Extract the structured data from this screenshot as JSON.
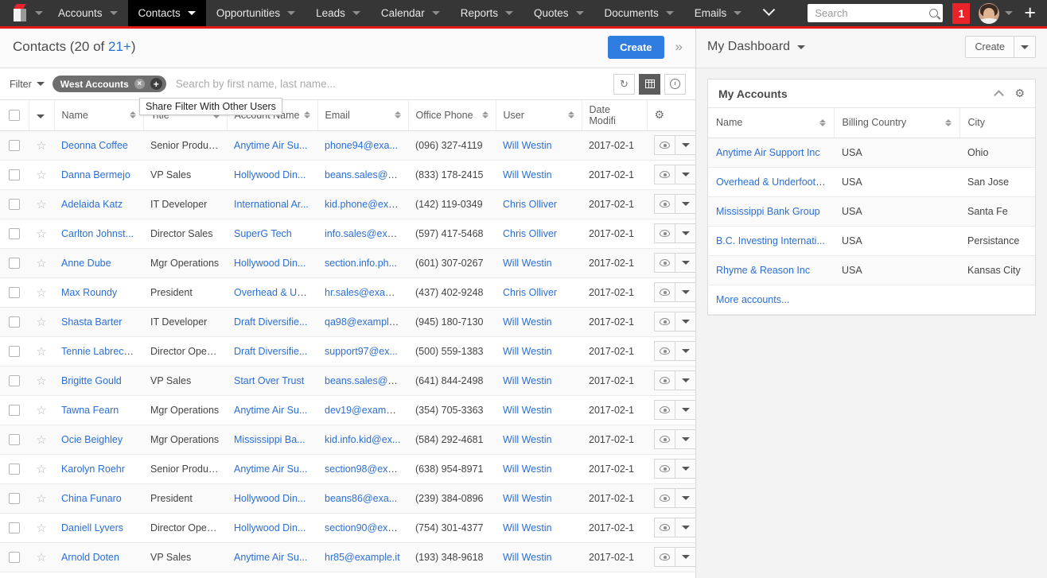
{
  "topnav": {
    "logo_icon": "cube-logo-icon",
    "items": [
      {
        "label": "Accounts",
        "active": false
      },
      {
        "label": "Contacts",
        "active": true
      },
      {
        "label": "Opportunities",
        "active": false
      },
      {
        "label": "Leads",
        "active": false
      },
      {
        "label": "Calendar",
        "active": false
      },
      {
        "label": "Reports",
        "active": false
      },
      {
        "label": "Quotes",
        "active": false
      },
      {
        "label": "Documents",
        "active": false
      },
      {
        "label": "Emails",
        "active": false
      }
    ],
    "search_placeholder": "Search",
    "search_value": "",
    "notification_count": "1",
    "plus_label": "+"
  },
  "list_header": {
    "title_prefix": "Contacts (20 of ",
    "title_count": "21+",
    "title_suffix": ")",
    "create_label": "Create",
    "expand_icon": "»"
  },
  "filter_bar": {
    "filter_label": "Filter",
    "pill_label": "West Accounts",
    "pill_remove": "×",
    "pill_add": "+",
    "search_placeholder": "Search by first name, last name...",
    "search_value": "",
    "tooltip": "Share Filter With Other Users",
    "tools": [
      "refresh-icon",
      "grid-view-icon",
      "timeline-view-icon"
    ]
  },
  "table": {
    "columns": [
      "Name",
      "Title",
      "Account Name",
      "Email",
      "Office Phone",
      "User",
      "Date Modifi"
    ],
    "rows": [
      {
        "name": "Deonna Coffee",
        "title": "Senior Product...",
        "account": "Anytime Air Su...",
        "email": "phone94@exa...",
        "phone": "(096) 327-4119",
        "user": "Will Westin",
        "date": "2017-02-1"
      },
      {
        "name": "Danna Bermejo",
        "title": "VP Sales",
        "account": "Hollywood Din...",
        "email": "beans.sales@e...",
        "phone": "(833) 178-2415",
        "user": "Will Westin",
        "date": "2017-02-1"
      },
      {
        "name": "Adelaida Katz",
        "title": "IT Developer",
        "account": "International Ar...",
        "email": "kid.phone@exa...",
        "phone": "(142) 119-0349",
        "user": "Chris Olliver",
        "date": "2017-02-1"
      },
      {
        "name": "Carlton Johnst...",
        "title": "Director Sales",
        "account": "SuperG Tech",
        "email": "info.sales@exa...",
        "phone": "(597) 417-5468",
        "user": "Chris Olliver",
        "date": "2017-02-1"
      },
      {
        "name": "Anne Dube",
        "title": "Mgr Operations",
        "account": "Hollywood Din...",
        "email": "section.info.ph...",
        "phone": "(601) 307-0267",
        "user": "Will Westin",
        "date": "2017-02-1"
      },
      {
        "name": "Max Roundy",
        "title": "President",
        "account": "Overhead & Un...",
        "email": "hr.sales@exam...",
        "phone": "(437) 402-9248",
        "user": "Chris Olliver",
        "date": "2017-02-1"
      },
      {
        "name": "Shasta Barter",
        "title": "IT Developer",
        "account": "Draft Diversifie...",
        "email": "qa98@example...",
        "phone": "(945) 180-7130",
        "user": "Will Westin",
        "date": "2017-02-1"
      },
      {
        "name": "Tennie Labrecque",
        "title": "Director Operat...",
        "account": "Draft Diversifie...",
        "email": "support97@ex...",
        "phone": "(500) 559-1383",
        "user": "Will Westin",
        "date": "2017-02-1"
      },
      {
        "name": "Brigitte Gould",
        "title": "VP Sales",
        "account": "Start Over Trust",
        "email": "beans.sales@e...",
        "phone": "(641) 844-2498",
        "user": "Will Westin",
        "date": "2017-02-1"
      },
      {
        "name": "Tawna Fearn",
        "title": "Mgr Operations",
        "account": "Anytime Air Su...",
        "email": "dev19@exampl...",
        "phone": "(354) 705-3363",
        "user": "Will Westin",
        "date": "2017-02-1"
      },
      {
        "name": "Ocie Beighley",
        "title": "Mgr Operations",
        "account": "Mississippi Ba...",
        "email": "kid.info.kid@ex...",
        "phone": "(584) 292-4681",
        "user": "Will Westin",
        "date": "2017-02-1"
      },
      {
        "name": "Karolyn Roehr",
        "title": "Senior Product...",
        "account": "Anytime Air Su...",
        "email": "section98@exa...",
        "phone": "(638) 954-8971",
        "user": "Will Westin",
        "date": "2017-02-1"
      },
      {
        "name": "China Funaro",
        "title": "President",
        "account": "Hollywood Din...",
        "email": "beans86@exa...",
        "phone": "(239) 384-0896",
        "user": "Will Westin",
        "date": "2017-02-1"
      },
      {
        "name": "Daniell Lyvers",
        "title": "Director Operat...",
        "account": "Hollywood Din...",
        "email": "section90@exa...",
        "phone": "(754) 301-4377",
        "user": "Will Westin",
        "date": "2017-02-1"
      },
      {
        "name": "Arnold Doten",
        "title": "VP Sales",
        "account": "Anytime Air Su...",
        "email": "hr85@example.it",
        "phone": "(193) 348-9618",
        "user": "Will Westin",
        "date": "2017-02-1"
      }
    ]
  },
  "dashboard": {
    "title": "My Dashboard",
    "create_label": "Create",
    "card": {
      "title": "My Accounts",
      "columns": [
        "Name",
        "Billing Country",
        "City"
      ],
      "rows": [
        {
          "name": "Anytime Air Support Inc",
          "country": "USA",
          "city": "Ohio"
        },
        {
          "name": "Overhead & Underfoot ...",
          "country": "USA",
          "city": "San Jose"
        },
        {
          "name": "Mississippi Bank Group",
          "country": "USA",
          "city": "Santa Fe"
        },
        {
          "name": "B.C. Investing Internati...",
          "country": "USA",
          "city": "Persistance"
        },
        {
          "name": "Rhyme & Reason Inc",
          "country": "USA",
          "city": "Kansas City"
        }
      ],
      "more_label": "More accounts..."
    }
  },
  "colors": {
    "nav_bg": "#363636",
    "nav_active": "#000000",
    "accent_red": "#e61718",
    "link_blue": "#2b6fd6",
    "button_blue": "#2f7de1",
    "pill_grey": "#6e6e6e"
  }
}
